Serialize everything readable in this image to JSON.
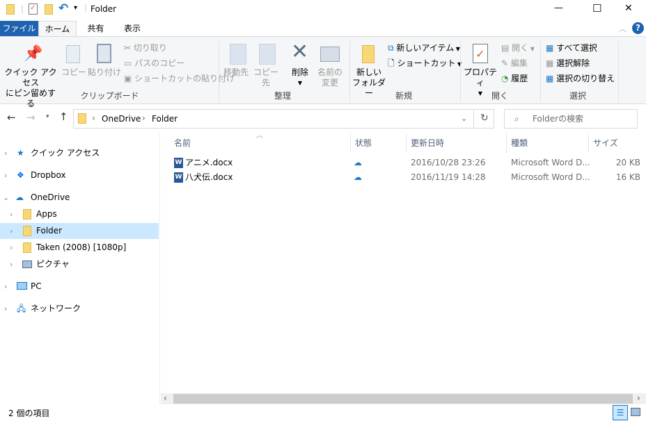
{
  "window": {
    "title": "Folder",
    "minimize": "—",
    "maximize": "☐",
    "close": "✕"
  },
  "tabs": [
    {
      "label": "ファイル"
    },
    {
      "label": "ホーム"
    },
    {
      "label": "共有"
    },
    {
      "label": "表示"
    }
  ],
  "help": "?",
  "ribbon": {
    "clipboard": {
      "label": "クリップボード",
      "pin": "クイック アクセス",
      "pin2": "にピン留めする",
      "copy": "コピー",
      "paste": "貼り付け",
      "cut": "切り取り",
      "copy_path": "パスのコピー",
      "paste_shortcut": "ショートカットの貼り付け"
    },
    "organize": {
      "label": "整理",
      "move_to": "移動先",
      "copy_to": "コピー先",
      "delete": "削除",
      "rename1": "名前の",
      "rename2": "変更"
    },
    "new": {
      "label": "新規",
      "new_folder1": "新しい",
      "new_folder2": "フォルダー",
      "new_item": "新しいアイテム",
      "shortcut": "ショートカット"
    },
    "open": {
      "label": "開く",
      "properties": "プロパティ",
      "open": "開く",
      "edit": "編集",
      "history": "履歴"
    },
    "select": {
      "label": "選択",
      "select_all": "すべて選択",
      "select_none": "選択解除",
      "invert": "選択の切り替え"
    }
  },
  "address": {
    "path": [
      "OneDrive",
      "Folder"
    ],
    "search_placeholder": "Folderの検索"
  },
  "sidebar": [
    {
      "label": "クイック アクセス"
    },
    {
      "label": "Dropbox"
    },
    {
      "label": "OneDrive"
    },
    {
      "label": "Apps"
    },
    {
      "label": "Folder"
    },
    {
      "label": "Taken (2008) [1080p]"
    },
    {
      "label": "ピクチャ"
    },
    {
      "label": "PC"
    },
    {
      "label": "ネットワーク"
    }
  ],
  "columns": {
    "name": "名前",
    "status": "状態",
    "date": "更新日時",
    "type": "種類",
    "size": "サイズ"
  },
  "files": [
    {
      "name": "アニメ.docx",
      "date": "2016/10/28 23:26",
      "type": "Microsoft Word D...",
      "size": "20 KB"
    },
    {
      "name": "八犬伝.docx",
      "date": "2016/11/19 14:28",
      "type": "Microsoft Word D...",
      "size": "16 KB"
    }
  ],
  "status": {
    "count": "2 個の項目"
  },
  "colors": {
    "file_tab": "#1e62b0",
    "selected": "#cce8ff",
    "accent": "#1979ca"
  }
}
